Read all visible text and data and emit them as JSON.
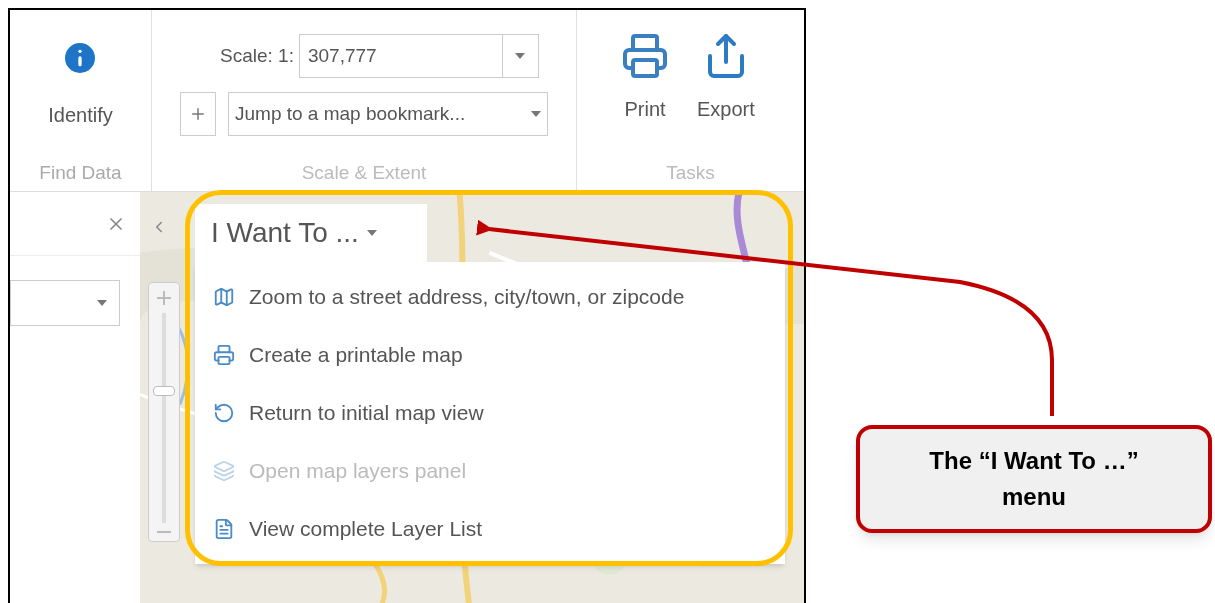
{
  "ribbon": {
    "find_data": {
      "label": "Find Data",
      "buttons": [
        {
          "label": "Identify"
        }
      ]
    },
    "scale_extent": {
      "label": "Scale & Extent",
      "scale_label": "Scale: 1:",
      "scale_value": "307,777",
      "bookmark": "Jump to a map bookmark..."
    },
    "tasks": {
      "label": "Tasks",
      "buttons": [
        {
          "label": "Print"
        },
        {
          "label": "Export"
        }
      ]
    }
  },
  "zoom_slider": {
    "level": 0.63
  },
  "i_want_to": {
    "label": "I Want To ...",
    "items": [
      {
        "label": "Zoom to a street address, city/town, or zipcode",
        "disabled": false
      },
      {
        "label": "Create a printable map",
        "disabled": false
      },
      {
        "label": "Return to initial map view",
        "disabled": false
      },
      {
        "label": "Open map layers panel",
        "disabled": true
      },
      {
        "label": "View complete Layer List",
        "disabled": false
      }
    ]
  },
  "callout": {
    "line_1": "The “I Want To …”",
    "line_2": "menu"
  }
}
